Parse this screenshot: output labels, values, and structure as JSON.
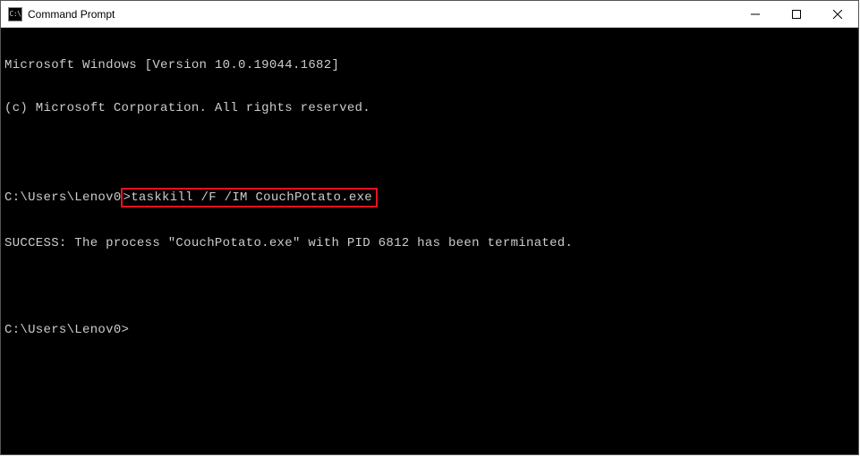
{
  "window": {
    "title": "Command Prompt",
    "icon_label": "C:\\"
  },
  "terminal": {
    "line1": "Microsoft Windows [Version 10.0.19044.1682]",
    "line2": "(c) Microsoft Corporation. All rights reserved.",
    "blank1": "",
    "prompt1_prefix": "C:\\Users\\Lenov0",
    "prompt1_gt": ">",
    "command1": "taskkill /F /IM CouchPotato.exe",
    "output1": "SUCCESS: The process \"CouchPotato.exe\" with PID 6812 has been terminated.",
    "blank2": "",
    "prompt2": "C:\\Users\\Lenov0>"
  }
}
